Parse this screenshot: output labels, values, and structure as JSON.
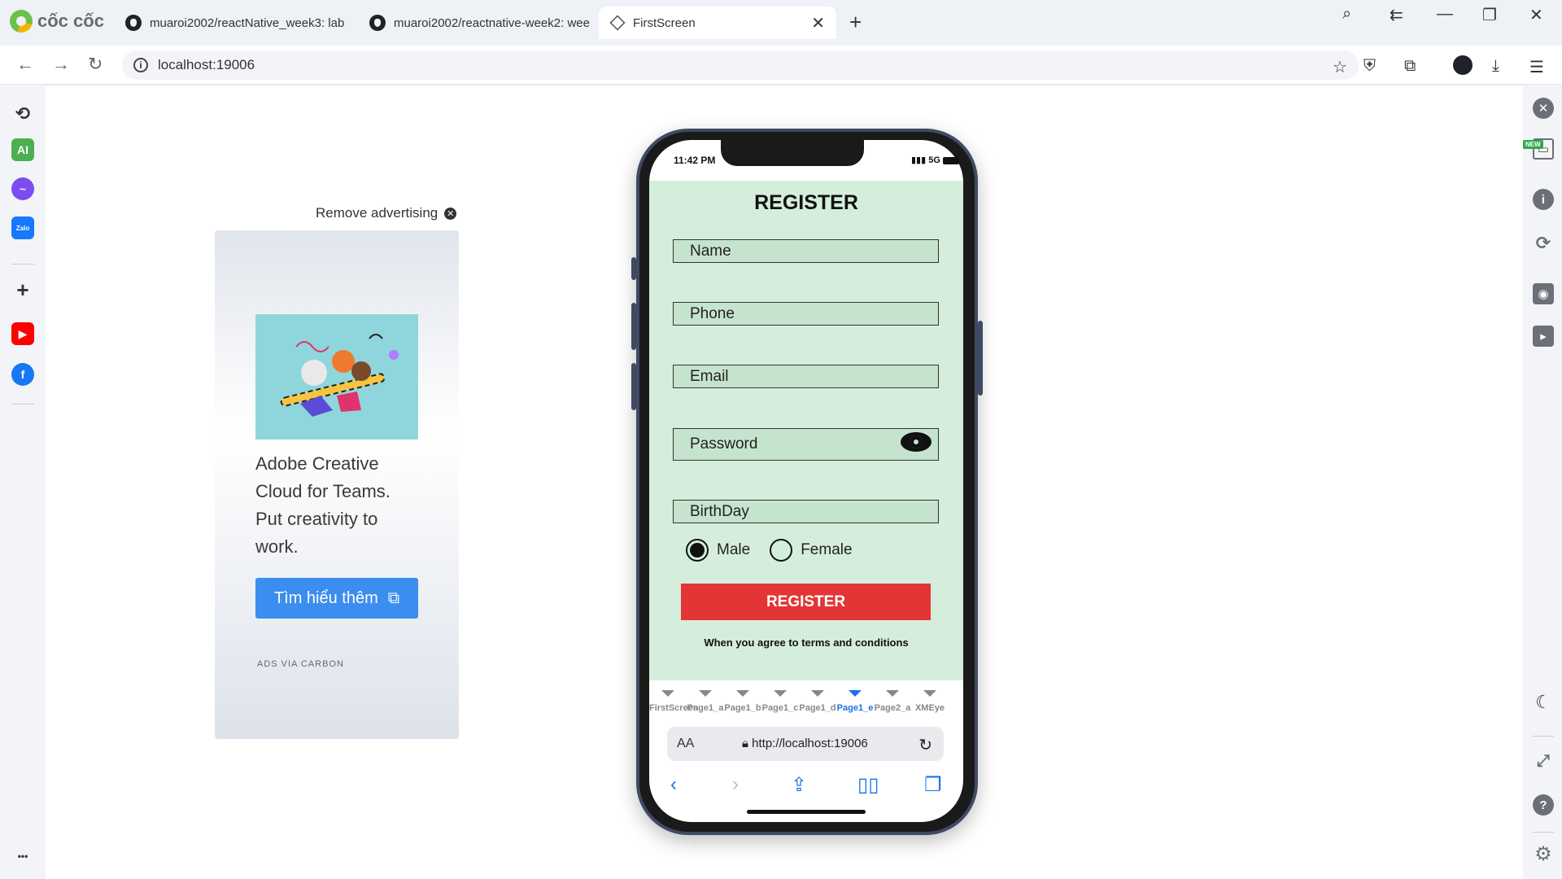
{
  "browser": {
    "brand": "cốc cốc",
    "tabs": [
      {
        "title": "muaroi2002/reactNative_week3: lab",
        "active": false
      },
      {
        "title": "muaroi2002/reactnative-week2: wee",
        "active": false
      },
      {
        "title": "FirstScreen",
        "active": true
      }
    ],
    "new_tab": "+",
    "address": "localhost:19006"
  },
  "left_sidebar": {
    "items": [
      "history-icon",
      "ai-icon",
      "messenger-icon",
      "zalo-icon",
      "add-icon",
      "youtube-icon",
      "facebook-icon",
      "more-icon"
    ],
    "ai_label": "AI",
    "zalo_label": "Zalo",
    "more_label": "•••"
  },
  "right_sidebar": {
    "new_badge": "NEW",
    "items": [
      "close-icon",
      "responsive-icon",
      "info-icon",
      "rotate-icon",
      "camera-icon",
      "video-icon",
      "moon-icon",
      "share-icon",
      "help-icon",
      "gear-icon"
    ]
  },
  "ad": {
    "remove_label": "Remove advertising",
    "text": "Adobe Creative Cloud for Teams. Put creativity to work.",
    "button_label": "Tìm hiểu thêm",
    "via": "ADS VIA CARBON"
  },
  "phone": {
    "time": "11:42 PM",
    "network": "5G",
    "title": "REGISTER",
    "fields": {
      "name": "Name",
      "phone": "Phone",
      "email": "Email",
      "password": "Password",
      "birthday": "BirthDay"
    },
    "gender": {
      "male": "Male",
      "female": "Female",
      "selected": "Male"
    },
    "register_button": "REGISTER",
    "terms": "When you agree to terms and conditions",
    "nav_tabs": [
      "FirstScreen",
      "Page1_a",
      "Page1_b",
      "Page1_c",
      "Page1_d",
      "Page1_e",
      "Page2_a",
      "XMEye"
    ],
    "active_nav_tab": "Page1_e",
    "safari": {
      "aa": "AA",
      "url": "http://localhost:19006"
    }
  },
  "colors": {
    "app_background": "#d5eedb",
    "field_background": "#c6e4cd",
    "register_button": "#e33535",
    "ad_button": "#3b8ef0",
    "active_tab": "#1a73e8"
  }
}
